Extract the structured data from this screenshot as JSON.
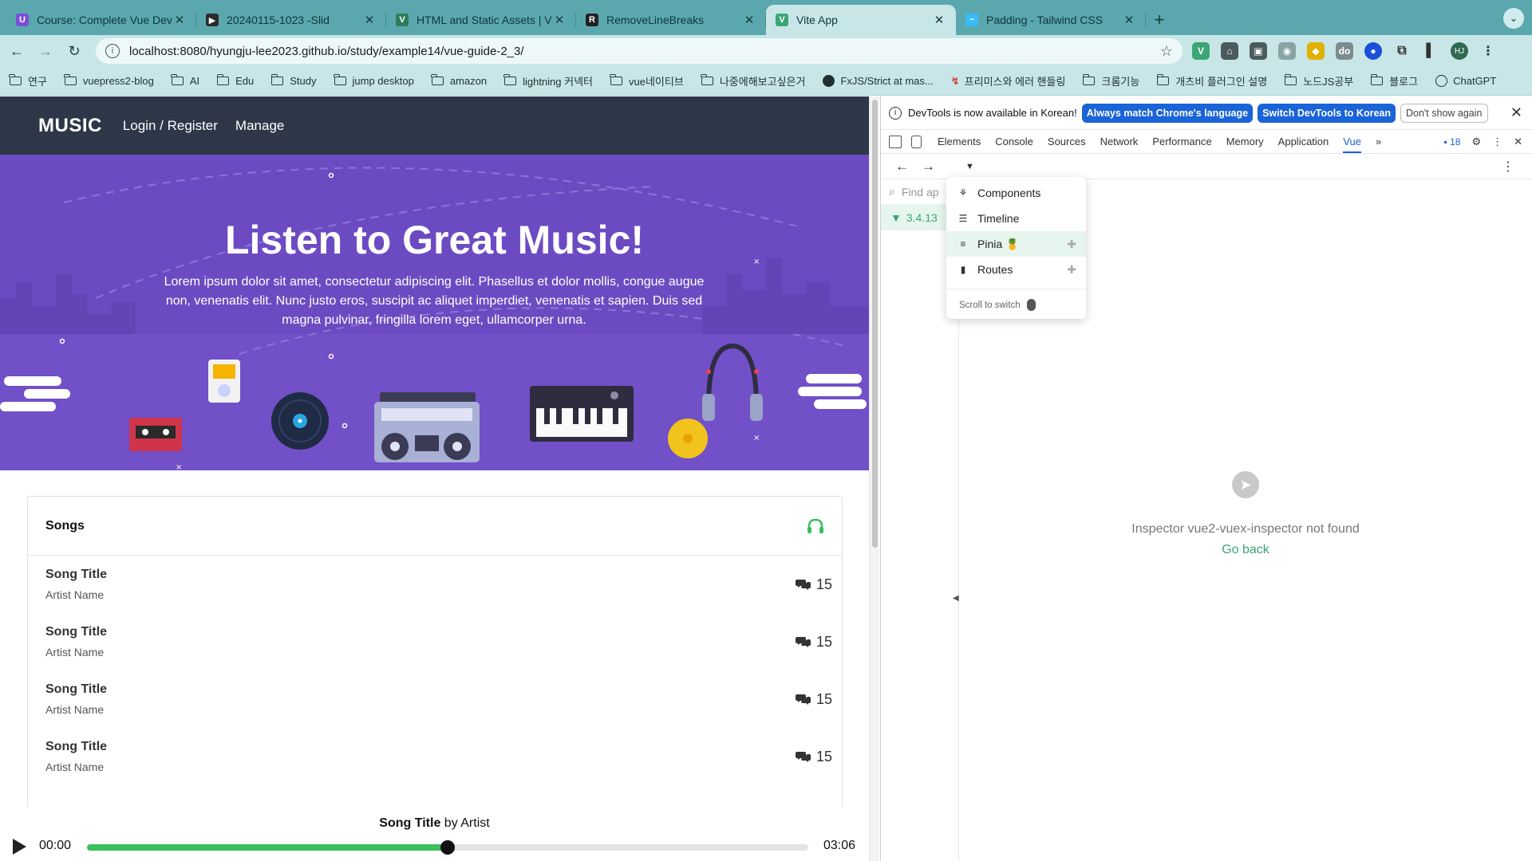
{
  "browser": {
    "tabs": [
      {
        "title": "Course: Complete Vue Develo",
        "icon_color": "#7a4fd6",
        "icon_char": "U",
        "active": false
      },
      {
        "title": "20240115-1023 -Slid",
        "icon_color": "#2b2b2b",
        "icon_char": "▶",
        "active": false
      },
      {
        "title": "HTML and Static Assets | Vue",
        "icon_color": "#2e7d5a",
        "icon_char": "V",
        "active": false
      },
      {
        "title": "RemoveLineBreaks",
        "icon_color": "#222222",
        "icon_char": "R",
        "active": false
      },
      {
        "title": "Vite App",
        "icon_color": "#3aa675",
        "icon_char": "V",
        "active": true
      },
      {
        "title": "Padding - Tailwind CSS",
        "icon_color": "#38bdf8",
        "icon_char": "~",
        "active": false
      }
    ],
    "new_tab_icon": "plus-icon",
    "url": "localhost:8080/hyungju-lee2023.github.io/study/example14/vue-guide-2_3/",
    "avatar_initials": "HJ",
    "bookmarks": [
      {
        "label": "연구",
        "kind": "folder"
      },
      {
        "label": "vuepress2-blog",
        "kind": "folder"
      },
      {
        "label": "AI",
        "kind": "folder"
      },
      {
        "label": "Edu",
        "kind": "folder"
      },
      {
        "label": "Study",
        "kind": "folder"
      },
      {
        "label": "jump desktop",
        "kind": "folder"
      },
      {
        "label": "amazon",
        "kind": "folder"
      },
      {
        "label": "lightning 커넥터",
        "kind": "folder"
      },
      {
        "label": "vue네이티브",
        "kind": "folder"
      },
      {
        "label": "나중에해보고싶은거",
        "kind": "folder"
      },
      {
        "label": "FxJS/Strict at mas...",
        "kind": "github"
      },
      {
        "label": "프리미스와 에러 핸들링",
        "kind": "red"
      },
      {
        "label": "크롬기능",
        "kind": "folder"
      },
      {
        "label": "개츠비 플러그인 설명",
        "kind": "folder"
      },
      {
        "label": "노드JS공부",
        "kind": "folder"
      },
      {
        "label": "블로그",
        "kind": "folder"
      },
      {
        "label": "ChatGPT",
        "kind": "gpt"
      }
    ]
  },
  "site": {
    "logo": "MUSIC",
    "nav": [
      "Login / Register",
      "Manage"
    ],
    "hero_title": "Listen to Great Music!",
    "hero_text": "Lorem ipsum dolor sit amet, consectetur adipiscing elit. Phasellus et dolor mollis, congue augue non, venenatis elit. Nunc justo eros, suscipit ac aliquet imperdiet, venenatis et sapien. Duis sed magna pulvinar, fringilla lorem eget, ullamcorper urna.",
    "songs_heading": "Songs",
    "songs": [
      {
        "title": "Song Title",
        "artist": "Artist Name",
        "comments": "15"
      },
      {
        "title": "Song Title",
        "artist": "Artist Name",
        "comments": "15"
      },
      {
        "title": "Song Title",
        "artist": "Artist Name",
        "comments": "15"
      },
      {
        "title": "Song Title",
        "artist": "Artist Name",
        "comments": "15"
      }
    ],
    "player": {
      "song_title": "Song Title",
      "by_text": "by Artist",
      "current_time": "00:00",
      "duration": "03:06",
      "progress_fraction": 0.5
    },
    "colors": {
      "header": "#2d3748",
      "hero": "#6c4bc2",
      "accent_green": "#3cbf5f"
    }
  },
  "devtools": {
    "info_text": "DevTools is now available in Korean!",
    "btn_match": "Always match Chrome's language",
    "btn_switch": "Switch DevTools to Korean",
    "btn_dont_show": "Don't show again",
    "tabs": [
      "Elements",
      "Console",
      "Sources",
      "Network",
      "Performance",
      "Memory",
      "Application",
      "Vue"
    ],
    "active_tab": "Vue",
    "more_tabs": "»",
    "issues_count": "18",
    "find_placeholder": "Find ap",
    "app_version": "3.4.13",
    "menu": [
      {
        "label": "Components",
        "icon": "components-icon"
      },
      {
        "label": "Timeline",
        "icon": "timeline-icon"
      },
      {
        "label": "Pinia 🍍",
        "icon": "pinia-list-icon",
        "active": true,
        "plugin": true
      },
      {
        "label": "Routes",
        "icon": "routes-book-icon",
        "plugin": true
      }
    ],
    "scroll_hint": "Scroll to switch",
    "not_found_message": "Inspector vue2-vuex-inspector not found",
    "go_back": "Go back"
  }
}
